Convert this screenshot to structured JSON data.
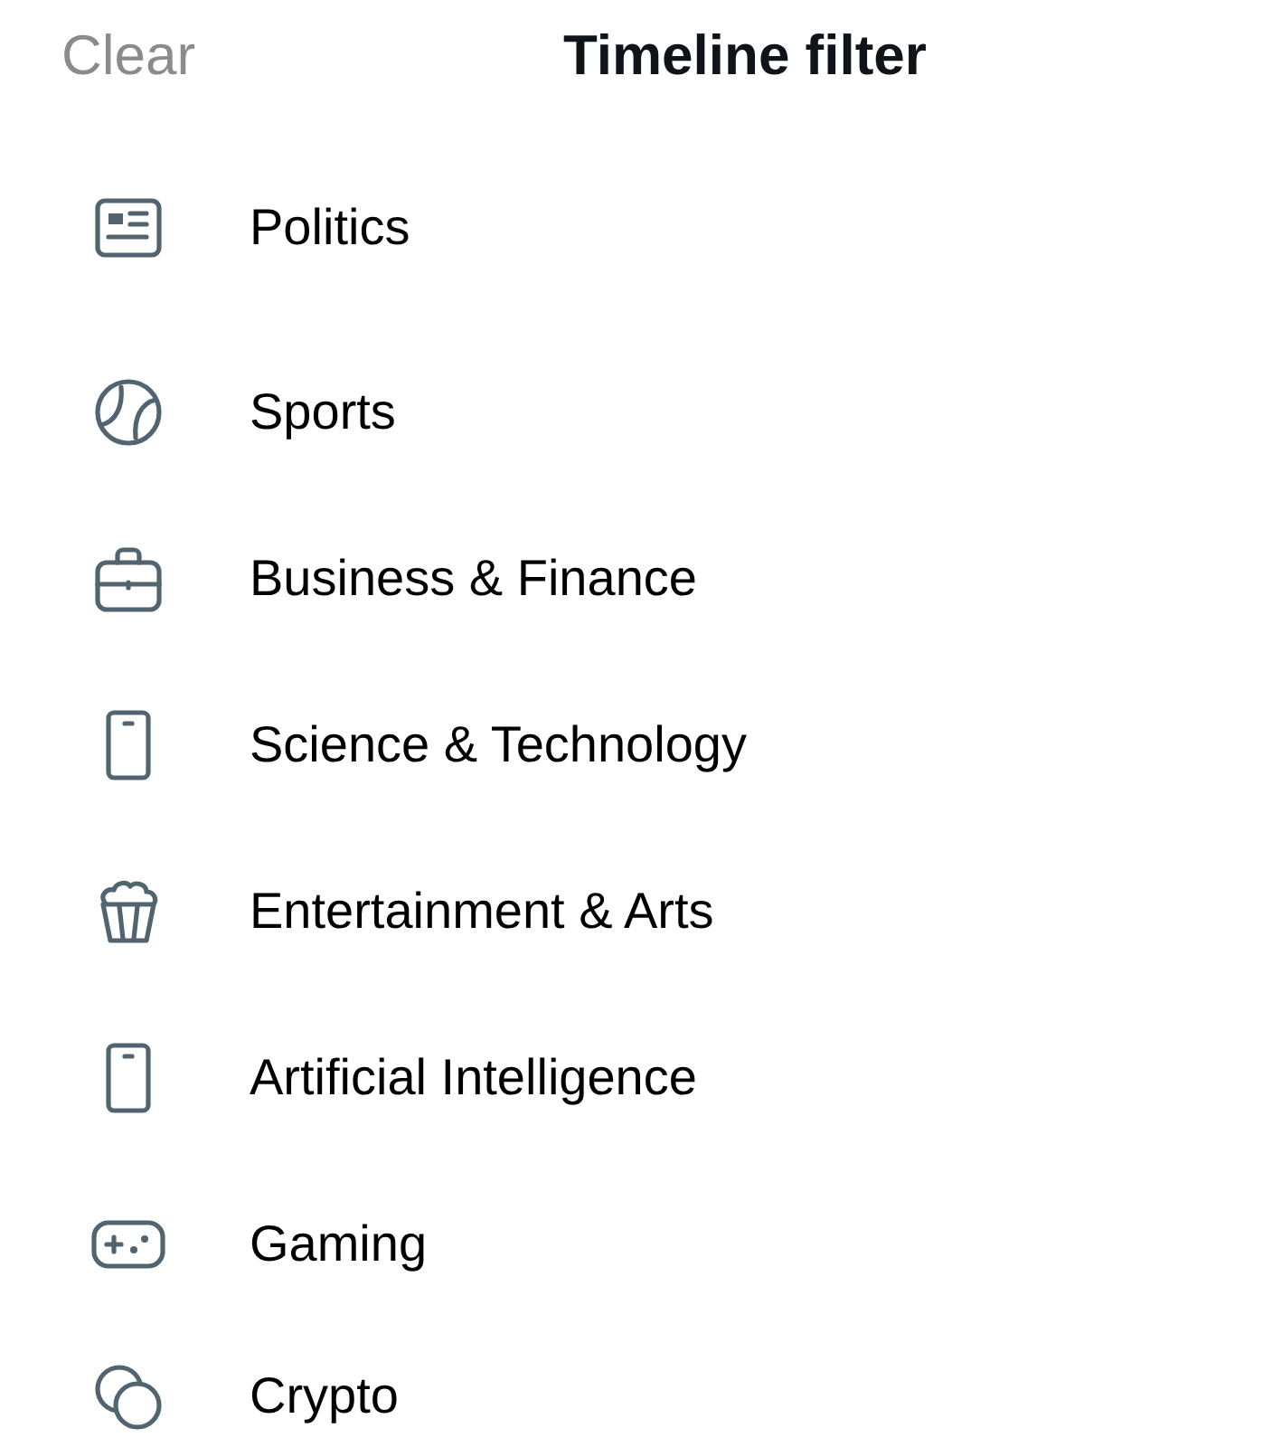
{
  "header": {
    "clear": "Clear",
    "title": "Timeline filter"
  },
  "topics": [
    {
      "kind": "newspaper",
      "label": "Politics"
    },
    {
      "kind": "ball",
      "label": "Sports"
    },
    {
      "kind": "briefcase",
      "label": "Business & Finance"
    },
    {
      "kind": "phone",
      "label": "Science & Technology"
    },
    {
      "kind": "popcorn",
      "label": "Entertainment & Arts"
    },
    {
      "kind": "phone",
      "label": "Artificial Intelligence"
    },
    {
      "kind": "gamepad",
      "label": "Gaming"
    },
    {
      "kind": "coins",
      "label": "Crypto"
    }
  ]
}
